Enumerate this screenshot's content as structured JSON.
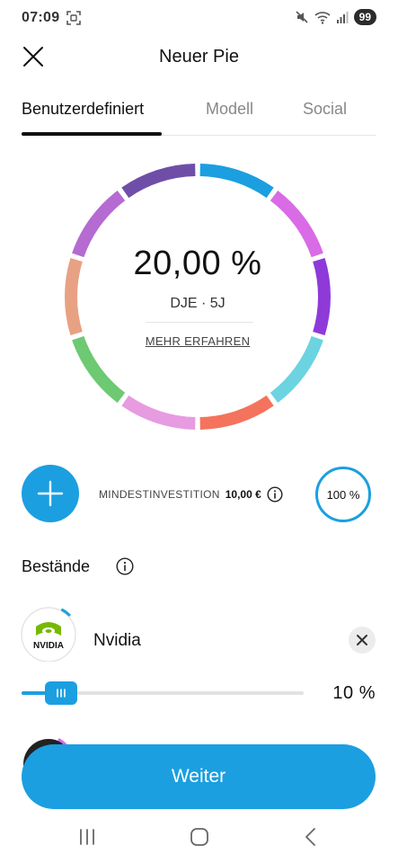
{
  "status_bar": {
    "time": "07:09",
    "battery": "99",
    "icons": [
      "screenshot-icon",
      "mute-icon",
      "wifi-icon",
      "signal-icon"
    ]
  },
  "header": {
    "title": "Neuer Pie",
    "close_icon": "close-icon"
  },
  "tabs": [
    {
      "label": "Benutzerdefiniert",
      "active": true
    },
    {
      "label": "Modell",
      "active": false
    },
    {
      "label": "Social",
      "active": false
    }
  ],
  "donut": {
    "percentage": "20,00 %",
    "fund": "DJE · 5J",
    "more_link": "MEHR ERFAHREN",
    "segment_colors": [
      "#1b9fe0",
      "#d96be6",
      "#8e3ad9",
      "#6cd3e0",
      "#f4735c",
      "#e79be0",
      "#6dc972",
      "#e8a183",
      "#b56bd1",
      "#6f4ea8"
    ]
  },
  "investment": {
    "min_label": "MINDESTINVESTITION",
    "min_value": "10,00 €",
    "total": "100 %",
    "add_icon": "plus-icon"
  },
  "holdings": {
    "title": "Bestände",
    "items": [
      {
        "name": "Nvidia",
        "logo_text": "NVIDIA",
        "allocation": "10 %",
        "allocation_fraction": 0.1
      }
    ]
  },
  "cta": {
    "label": "Weiter"
  },
  "colors": {
    "accent": "#1b9fe0"
  }
}
